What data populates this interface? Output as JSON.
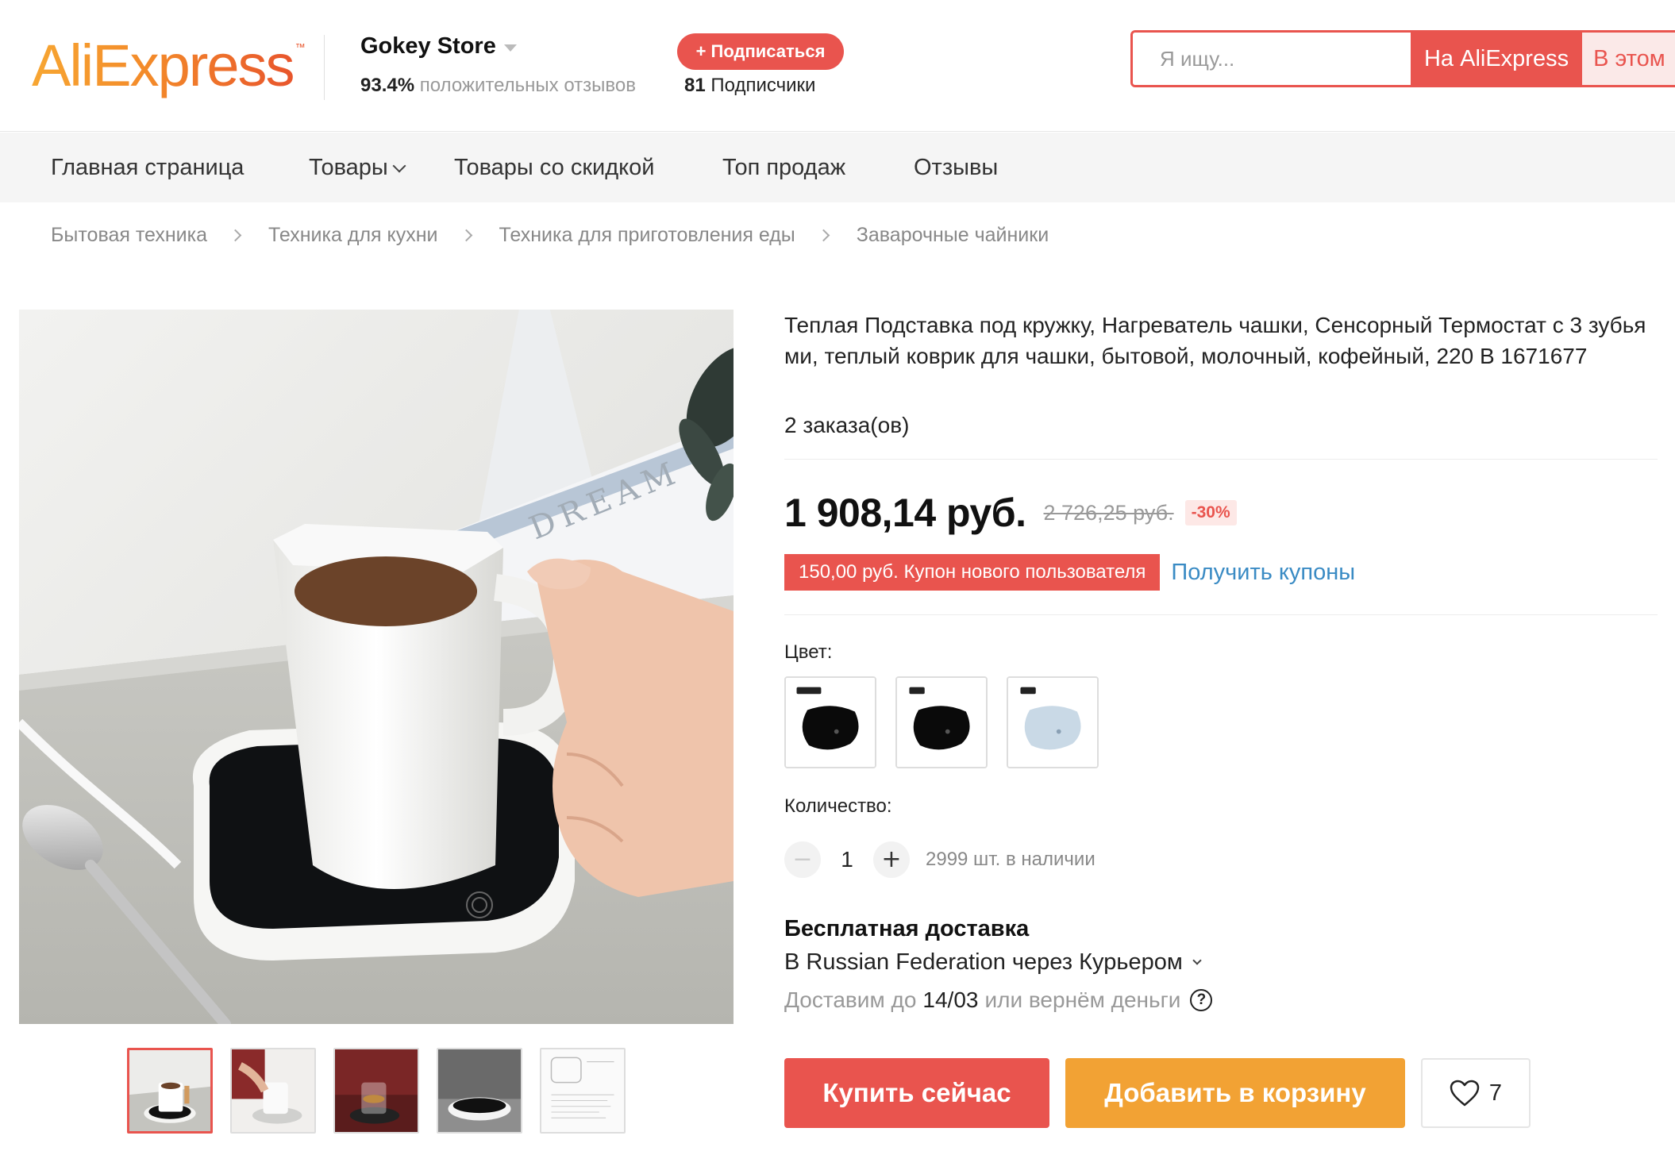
{
  "header": {
    "logo_text": "AliExpress",
    "logo_tm": "™",
    "store_name": "Gokey Store",
    "rating_value": "93.4%",
    "rating_label": " положительных отзывов",
    "follow_label": "+ Подписаться",
    "followers_count": "81",
    "followers_label": " Подписчики",
    "search_placeholder": "Я ищу...",
    "search_ali_label": "На AliExpress",
    "search_store_label": "В этом"
  },
  "nav": {
    "items": [
      "Главная страница",
      "Товары",
      "Товары со скидкой",
      "Топ продаж",
      "Отзывы"
    ]
  },
  "breadcrumb": [
    "Бытовая техника",
    "Техника для кухни",
    "Техника для приготовления еды",
    "Заварочные чайники"
  ],
  "gallery": {
    "thumbnail_count": 5,
    "active_index": 0,
    "book_text": "DREAM"
  },
  "product": {
    "title": "Теплая Подставка под кружку, Нагреватель чашки, Сенсорный Термостат с 3 зубьями, теплый коврик для чашки, бытовой, молочный, кофейный, 220 В 1671677",
    "orders": "2 заказа(ов)",
    "price_current": "1 908,14 руб.",
    "price_old": "2 726,25 руб.",
    "discount": "-30%",
    "coupon_text": "150,00 руб. Купон нового пользователя",
    "coupon_link": "Получить купоны",
    "color_label": "Цвет:",
    "colors": [
      {
        "name": "black-with-box",
        "swatch": "#111111"
      },
      {
        "name": "black",
        "swatch": "#111111"
      },
      {
        "name": "light-blue",
        "swatch": "#c9d9e6"
      }
    ],
    "quantity_label": "Количество:",
    "quantity_minus": "−",
    "quantity_value": "1",
    "quantity_plus": "+",
    "stock": "2999 шт. в наличии",
    "shipping_title": "Бесплатная доставка",
    "shipping_method": "В Russian Federation через Курьером",
    "delivery_prefix": "Доставим до",
    "delivery_date": "14/03",
    "delivery_suffix": "или вернём деньги",
    "help_glyph": "?",
    "buy_label": "Купить сейчас",
    "cart_label": "Добавить в корзину",
    "wishlist_count": "7"
  },
  "colors": {
    "accent": "#e9544e",
    "cart": "#f2a234",
    "link": "#3a8bc4"
  }
}
